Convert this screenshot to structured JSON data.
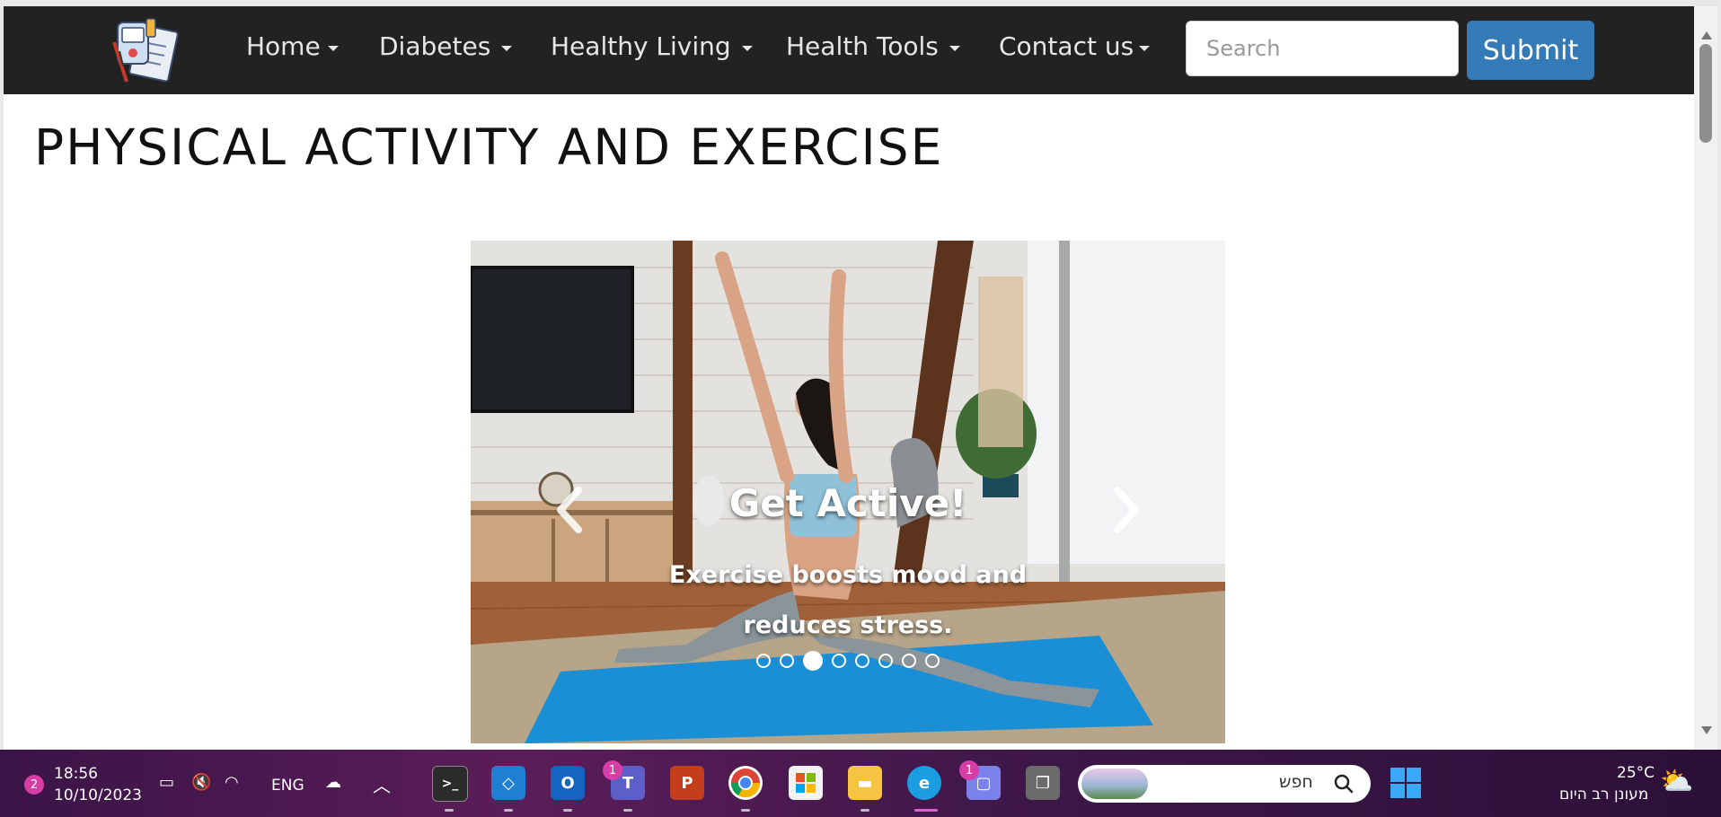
{
  "navbar": {
    "items": [
      {
        "label": "Home"
      },
      {
        "label": "Diabetes"
      },
      {
        "label": "Healthy Living"
      },
      {
        "label": "Health Tools"
      },
      {
        "label": "Contact us"
      }
    ],
    "search_placeholder": "Search",
    "submit_label": "Submit"
  },
  "page": {
    "title": "PHYSICAL ACTIVITY AND EXERCISE"
  },
  "carousel": {
    "caption_title": "Get Active!",
    "caption_text": "Exercise boosts mood and reduces stress.",
    "slide_count": 8,
    "active_slide": 3
  },
  "taskbar": {
    "notification_count": "2",
    "time": "18:56",
    "date": "10/10/2023",
    "language": "ENG",
    "teams_badge": "1",
    "chat_badge": "1",
    "search_placeholder": "חפש",
    "weather_temp": "25°C",
    "weather_desc": "מעונן רב היום"
  },
  "colors": {
    "navbar_bg": "#222222",
    "submit_bg": "#337ab7",
    "taskbar_bg": "#4a1a50"
  }
}
